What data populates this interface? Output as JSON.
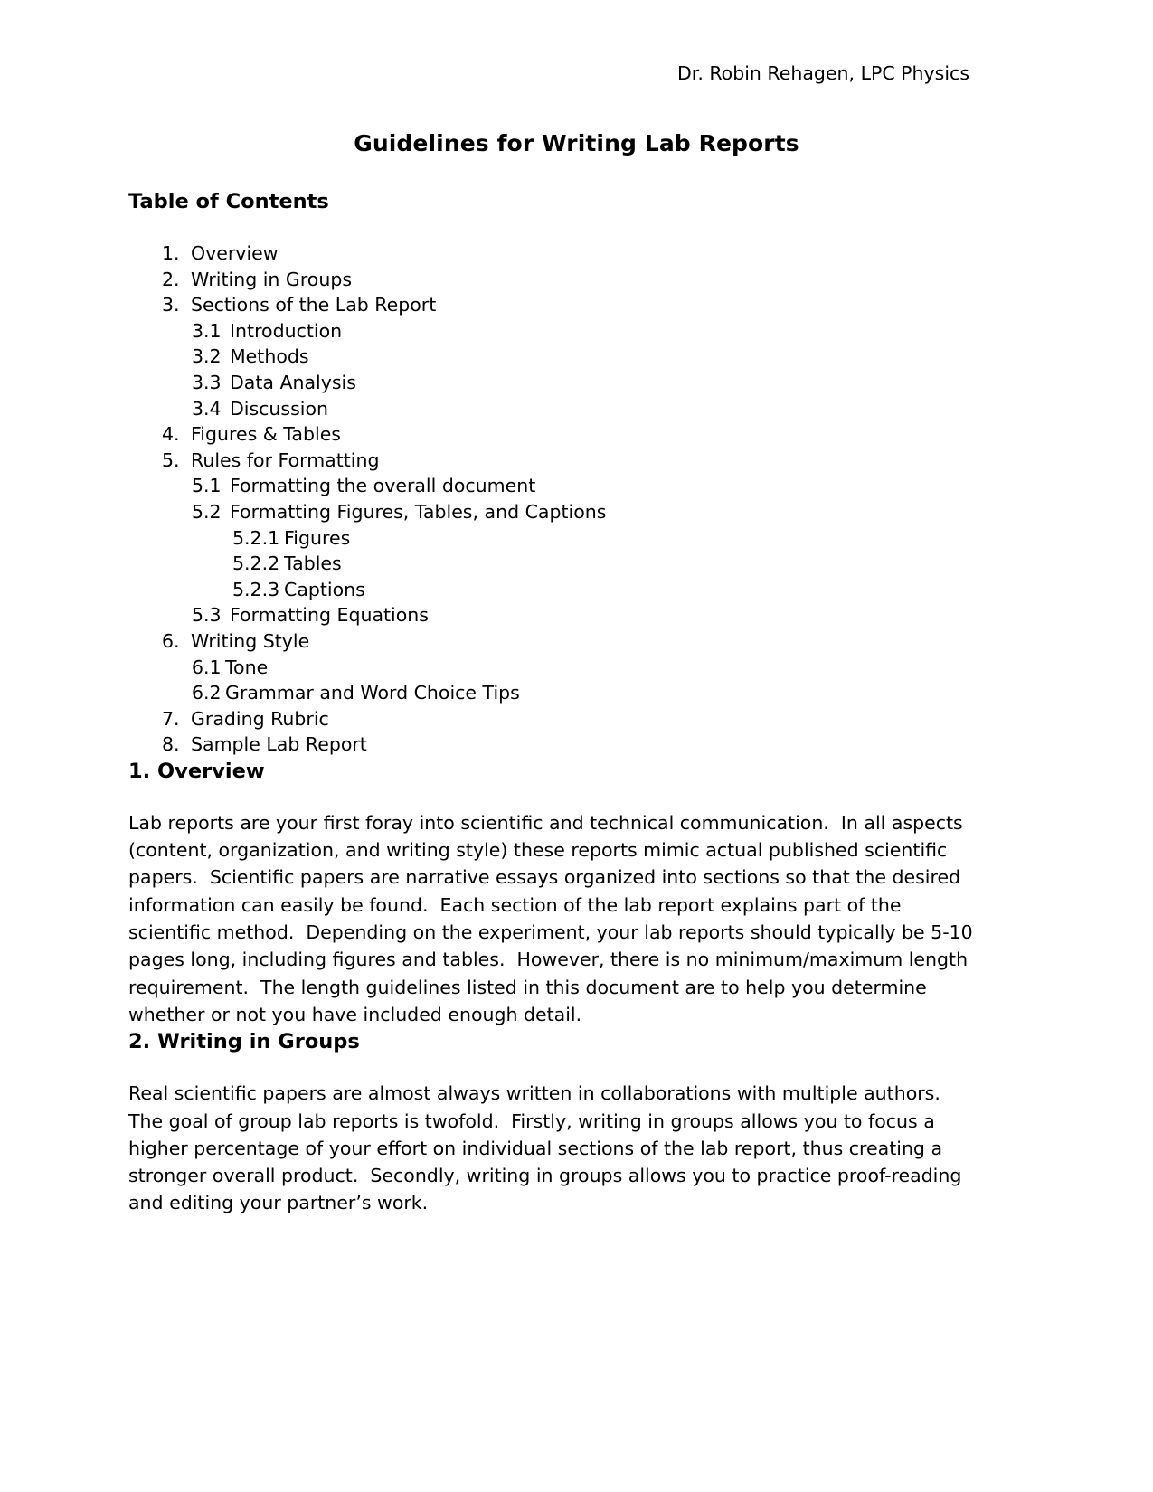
{
  "header": {
    "author_line": "Dr. Robin Rehagen, LPC Physics"
  },
  "document": {
    "title": "Guidelines for Writing Lab Reports"
  },
  "toc": {
    "heading": "Table of Contents",
    "entries": [
      {
        "number": "1.",
        "label": "Overview",
        "level": 1
      },
      {
        "number": "2.",
        "label": "Writing in Groups",
        "level": 1
      },
      {
        "number": "3.",
        "label": "Sections of the Lab Report",
        "level": 1
      },
      {
        "number": "3.1",
        "label": "Introduction",
        "level": 2
      },
      {
        "number": "3.2",
        "label": "Methods",
        "level": 2
      },
      {
        "number": "3.3",
        "label": "Data Analysis",
        "level": 2
      },
      {
        "number": "3.4",
        "label": "Discussion",
        "level": 2
      },
      {
        "number": "4.",
        "label": "Figures & Tables",
        "level": 1
      },
      {
        "number": "5.",
        "label": "Rules for Formatting",
        "level": 1
      },
      {
        "number": "5.1",
        "label": "Formatting the overall document",
        "level": 2
      },
      {
        "number": "5.2",
        "label": "Formatting Figures, Tables, and Captions",
        "level": 2
      },
      {
        "number": "5.2.1",
        "label": "Figures",
        "level": 3
      },
      {
        "number": "5.2.2",
        "label": "Tables",
        "level": 3
      },
      {
        "number": "5.2.3",
        "label": "Captions",
        "level": 3
      },
      {
        "number": "5.3",
        "label": "Formatting Equations",
        "level": 2
      },
      {
        "number": "6.",
        "label": "Writing Style",
        "level": 1
      },
      {
        "number": "6.1",
        "label": "Tone",
        "level": 2
      },
      {
        "number": "6.2",
        "label": "Grammar and Word Choice Tips",
        "level": 2
      },
      {
        "number": "7.",
        "label": "Grading Rubric",
        "level": 1
      },
      {
        "number": "8.",
        "label": "Sample Lab Report",
        "level": 1
      }
    ]
  },
  "sections": [
    {
      "heading": "1. Overview",
      "paragraph": "Lab reports are your first foray into scientific and technical communication.  In all aspects (content, organization, and writing style) these reports mimic actual published scientific papers.  Scientific papers are narrative essays organized into sections so that the desired information can easily be found.  Each section of the lab report explains part of the scientific method.  Depending on the experiment, your lab reports should typically be 5-10 pages long, including figures and tables.  However, there is no minimum/maximum length requirement.  The length guidelines listed in this document are to help you determine whether or not you have included enough detail."
    },
    {
      "heading": "2. Writing in Groups",
      "paragraph": "Real scientific papers are almost always written in collaborations with multiple authors.  The goal of group lab reports is twofold.  Firstly, writing in groups allows you to focus a higher percentage of your effort on individual sections of the lab report, thus creating a stronger overall product.  Secondly, writing in groups allows you to practice proof-reading and editing your partner’s work."
    }
  ]
}
